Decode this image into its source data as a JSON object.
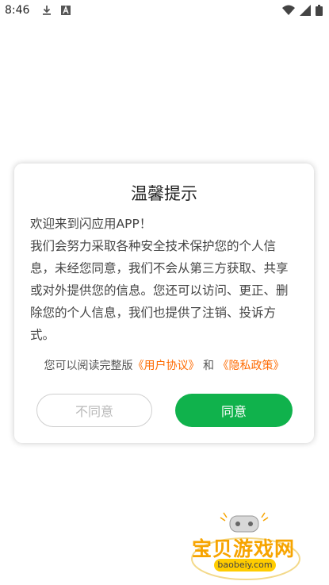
{
  "status_bar": {
    "time": "8:46",
    "icons": [
      "download-icon",
      "font-icon",
      "wifi-icon",
      "signal-icon",
      "battery-icon"
    ]
  },
  "dialog": {
    "title": "温馨提示",
    "body_line_1": "欢迎来到闪应用APP！",
    "body_paragraph": "我们会努力采取各种安全技术保护您的个人信息，未经您同意，我们不会从第三方获取、共享或对外提供您的信息。您还可以访问、更正、删除您的个人信息，我们也提供了注销、投诉方式。",
    "links_prefix": "您可以阅读完整版",
    "user_agreement": "《用户协议》",
    "links_and": "和",
    "privacy_policy": "《隐私政策》",
    "disagree_label": "不同意",
    "agree_label": "同意"
  },
  "watermark": {
    "title": "宝贝游戏网",
    "url": "baobeiy.com"
  },
  "colors": {
    "accent_green": "#10b24c",
    "link_orange": "#ff6a00",
    "watermark_gold": "#f7a400"
  }
}
